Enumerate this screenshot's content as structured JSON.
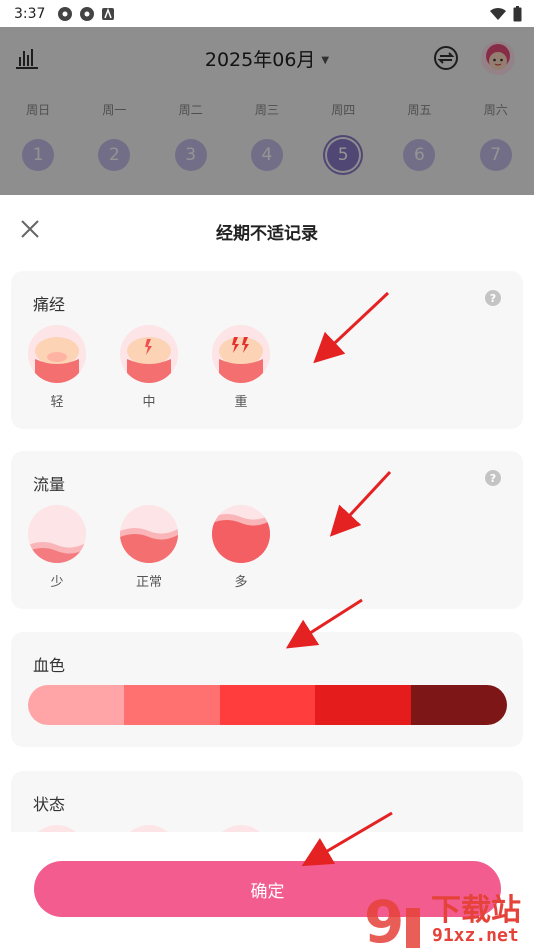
{
  "status_bar": {
    "time": "3:37"
  },
  "calendar": {
    "month_title": "2025年06月",
    "weekdays": [
      "周日",
      "周一",
      "周二",
      "周三",
      "周四",
      "周五",
      "周六"
    ],
    "days": [
      "1",
      "2",
      "3",
      "4",
      "5",
      "6",
      "7"
    ],
    "today_index": 4
  },
  "sheet": {
    "title": "经期不适记录",
    "dysmenorrhea": {
      "title": "痛经",
      "help": "?",
      "options": [
        "轻",
        "中",
        "重"
      ]
    },
    "flow": {
      "title": "流量",
      "help": "?",
      "options": [
        "少",
        "正常",
        "多"
      ]
    },
    "blood_color": {
      "title": "血色",
      "colors": [
        "#ffa5a8",
        "#ff7070",
        "#ff3d3d",
        "#e41c1c",
        "#7d1717"
      ]
    },
    "state": {
      "title": "状态"
    },
    "confirm_label": "确定"
  },
  "watermark": {
    "brand": "下载站",
    "domain": "91xz.net"
  },
  "colors": {
    "accent": "#f35c8e",
    "arrow": "#e52222",
    "calendar_day": "#c6bde8"
  }
}
